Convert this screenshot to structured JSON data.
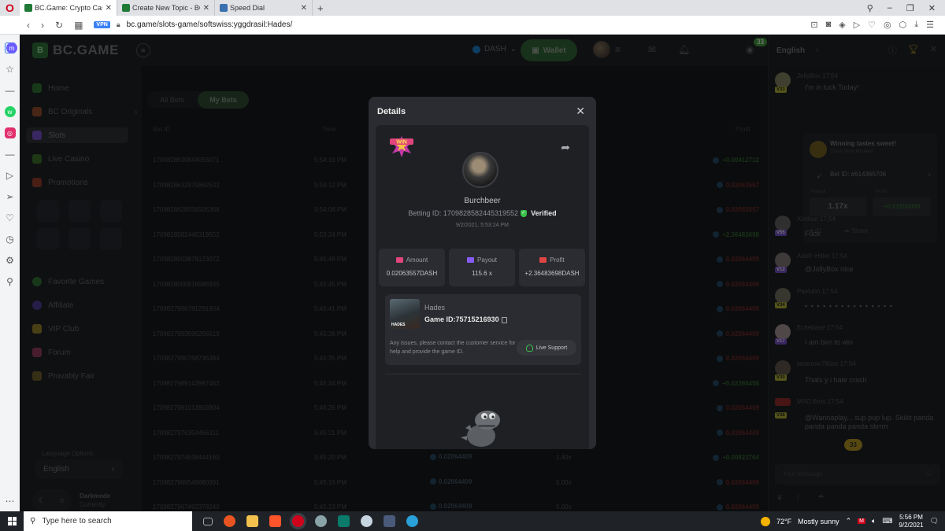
{
  "browser": {
    "tabs": [
      {
        "title": "BC.Game: Crypto Casino G",
        "close": "✕"
      },
      {
        "title": "Create New Topic - BC.Gam",
        "close": "✕"
      },
      {
        "title": "Speed Dial",
        "close": "✕"
      }
    ],
    "new_tab": "+",
    "vpn_label": "VPN",
    "url": "bc.game/slots-game/softswiss:yggdrasil:Hades/"
  },
  "site": {
    "logo_text": "BC.GAME",
    "currency": "DASH",
    "wallet_label": "Wallet",
    "chat_count": "33"
  },
  "sidebar": {
    "items": [
      {
        "label": "Home",
        "color": "#2d6b30"
      },
      {
        "label": "BC Originals",
        "color": "#8a4a2a"
      },
      {
        "label": "Slots",
        "color": "#6b4cb8"
      },
      {
        "label": "Live Casino",
        "color": "#3a6b2a"
      },
      {
        "label": "Promotions",
        "color": "#8a3a2a"
      },
      {
        "label": "Favorite Games",
        "color": "#2d6b30"
      },
      {
        "label": "Affiliate",
        "color": "#4a3a8a"
      },
      {
        "label": "VIP Club",
        "color": "#8a7a2a"
      },
      {
        "label": "Forum",
        "color": "#8a3a5a"
      },
      {
        "label": "Provably Fair",
        "color": "#6a5a2a"
      }
    ],
    "language_label": "Language Options",
    "language_value": "English",
    "darkmode_label": "Darkmode",
    "darkmode_sub": "Currently"
  },
  "bets": {
    "tabs": [
      "All Bets",
      "My Bets"
    ],
    "headers": {
      "bet_id": "Bet ID",
      "time": "Time",
      "profit": "Profit"
    },
    "rows": [
      {
        "id": "1709828639844056071",
        "time": "5:54:19 PM",
        "profit": "+0.00412712",
        "positive": true
      },
      {
        "id": "1709828632975862533",
        "time": "5:54:12 PM",
        "profit": "0.02063557",
        "positive": false
      },
      {
        "id": "1709828628556506368",
        "time": "5:54:08 PM",
        "profit": "0.02063557",
        "positive": false
      },
      {
        "id": "1709828582445319552",
        "time": "5:53:24 PM",
        "profit": "+2.36483698",
        "positive": true
      },
      {
        "id": "1709828003879123072",
        "time": "5:45:48 PM",
        "profit": "0.02064409",
        "positive": false
      },
      {
        "id": "1709828000816588935",
        "time": "5:45:45 PM",
        "profit": "0.02064409",
        "positive": false
      },
      {
        "id": "1709827996781291904",
        "time": "5:45:41 PM",
        "profit": "0.02064409",
        "positive": false
      },
      {
        "id": "1709827993596256519",
        "time": "5:45:38 PM",
        "profit": "0.02064409",
        "positive": false
      },
      {
        "id": "1709827990768736384",
        "time": "5:45:35 PM",
        "profit": "0.02064409",
        "positive": false
      },
      {
        "id": "1709827989143987463",
        "time": "5:45:34 PM",
        "profit": "+0.02386458",
        "positive": true
      },
      {
        "id": "1709827981013803904",
        "time": "5:45:26 PM",
        "profit": "0.02064409",
        "positive": false
      },
      {
        "id": "1709827976354466311",
        "time": "5:45:21 PM",
        "profit": "0.02064409",
        "positive": false
      },
      {
        "id": "1709827974638444160",
        "time": "5:45:20 PM",
        "profit": "+0.00823764",
        "positive": true,
        "amount": "0.02064409",
        "mult": "1.40x"
      },
      {
        "id": "1709827969549680391",
        "time": "5:45:15 PM",
        "profit": "0.02064409",
        "positive": false,
        "amount": "0.02064409",
        "mult": "0.00x"
      },
      {
        "id": "1709827967492378240",
        "time": "5:45:13 PM",
        "profit": "0.02064409",
        "positive": false,
        "amount": "0.02064409",
        "mult": "0.00x"
      }
    ]
  },
  "chat": {
    "language": "English",
    "messages": [
      {
        "name": "JollyBox",
        "time": "17:54",
        "vip": "V33",
        "text": "I'm in luck Today!"
      },
      {
        "name": "Ximfast",
        "time": "17:54",
        "vip": "V55",
        "text": "Fuck"
      },
      {
        "name": "Adolf~Hitler",
        "time": "17:54",
        "vip": "V12",
        "text": "@JollyBox nice"
      },
      {
        "name": "Paeluhn",
        "time": "17:54",
        "vip": "V34",
        "text": "▪ ▪ ▪ ▪ ▪ ▪ ▪ ▪ ▪ ▪ ▪ ▪ ▪ ▪ ▪"
      },
      {
        "name": "Echebase",
        "time": "17:54",
        "vip": "V17",
        "text": "I am birn to win"
      },
      {
        "name": "lanarose786ax",
        "time": "17:54",
        "vip": "V30",
        "text": "Thats y i hate crash"
      },
      {
        "name": "MAD Bros",
        "time": "17:54",
        "vip": "V38",
        "text": "@Wannaplay... sup pup lup. Skiliit panda panda panda panda skrrrrr"
      }
    ],
    "win_card": {
      "title": "Winning tastes sweet!",
      "subtitle": "Crash Wow Moment",
      "bet_id": "Bet ID: #614365706",
      "payout_label": "Payout",
      "profit_label": "Profit",
      "payout": "1.17x",
      "profit": "+0.01550000",
      "likes": "01",
      "share": "Share"
    },
    "unread": "33",
    "input_placeholder": "Your Message"
  },
  "modal": {
    "title": "Details",
    "close": "✕",
    "win_badge": "WIN",
    "player_name": "Burchbeer",
    "betting_id": "Betting ID: 1709828582445319552",
    "verified": "Verified",
    "date": "9/2/2021, 5:53:24 PM",
    "stats": [
      {
        "label": "Amount",
        "value": "0.02063557DASH",
        "color": "#e0457b"
      },
      {
        "label": "Payout",
        "value": "115.6 x",
        "color": "#8a5cf6"
      },
      {
        "label": "Profit",
        "value": "+2.36483698DASH",
        "color": "#e04545"
      }
    ],
    "game": {
      "thumb_text": "HADES",
      "name": "Hades",
      "game_id": "Game ID:75715216930",
      "help": "Any issues, please contact the customer service for help and provide the game ID.",
      "support_label": "Live Support"
    }
  },
  "taskbar": {
    "search_placeholder": "Type here to search",
    "weather_temp": "72°F",
    "weather_desc": "Mostly sunny",
    "time": "5:56 PM",
    "date": "9/2/2021"
  }
}
